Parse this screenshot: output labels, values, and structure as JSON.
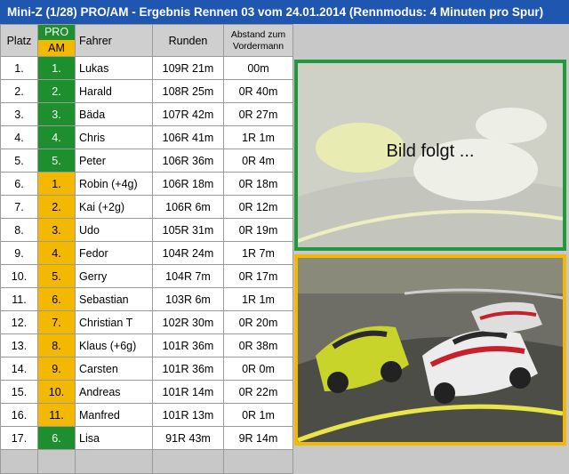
{
  "title": "Mini-Z (1/28) PRO/AM - Ergebnis Rennen 03 vom 24.01.2014 (Rennmodus: 4 Minuten pro Spur)",
  "headers": {
    "platz": "Platz",
    "pro": "PRO",
    "am": "AM",
    "fahrer": "Fahrer",
    "runden": "Runden",
    "abstand": "Abstand zum Vordermann"
  },
  "rows": [
    {
      "platz": "1.",
      "klasse": "pro",
      "klasse_platz": "1.",
      "fahrer": "Lukas",
      "runden": "109R 21m",
      "abstand": "00m"
    },
    {
      "platz": "2.",
      "klasse": "pro",
      "klasse_platz": "2.",
      "fahrer": "Harald",
      "runden": "108R 25m",
      "abstand": "0R 40m"
    },
    {
      "platz": "3.",
      "klasse": "pro",
      "klasse_platz": "3.",
      "fahrer": "Bäda",
      "runden": "107R 42m",
      "abstand": "0R 27m"
    },
    {
      "platz": "4.",
      "klasse": "pro",
      "klasse_platz": "4.",
      "fahrer": "Chris",
      "runden": "106R 41m",
      "abstand": "1R 1m"
    },
    {
      "platz": "5.",
      "klasse": "pro",
      "klasse_platz": "5.",
      "fahrer": "Peter",
      "runden": "106R 36m",
      "abstand": "0R 4m"
    },
    {
      "platz": "6.",
      "klasse": "am",
      "klasse_platz": "1.",
      "fahrer": "Robin (+4g)",
      "runden": "106R 18m",
      "abstand": "0R 18m"
    },
    {
      "platz": "7.",
      "klasse": "am",
      "klasse_platz": "2.",
      "fahrer": "Kai (+2g)",
      "runden": "106R 6m",
      "abstand": "0R 12m"
    },
    {
      "platz": "8.",
      "klasse": "am",
      "klasse_platz": "3.",
      "fahrer": "Udo",
      "runden": "105R 31m",
      "abstand": "0R 19m"
    },
    {
      "platz": "9.",
      "klasse": "am",
      "klasse_platz": "4.",
      "fahrer": "Fedor",
      "runden": "104R 24m",
      "abstand": "1R 7m"
    },
    {
      "platz": "10.",
      "klasse": "am",
      "klasse_platz": "5.",
      "fahrer": "Gerry",
      "runden": "104R 7m",
      "abstand": "0R 17m"
    },
    {
      "platz": "11.",
      "klasse": "am",
      "klasse_platz": "6.",
      "fahrer": "Sebastian",
      "runden": "103R 6m",
      "abstand": "1R 1m"
    },
    {
      "platz": "12.",
      "klasse": "am",
      "klasse_platz": "7.",
      "fahrer": "Christian T",
      "runden": "102R 30m",
      "abstand": "0R 20m"
    },
    {
      "platz": "13.",
      "klasse": "am",
      "klasse_platz": "8.",
      "fahrer": "Klaus (+6g)",
      "runden": "101R 36m",
      "abstand": "0R 38m"
    },
    {
      "platz": "14.",
      "klasse": "am",
      "klasse_platz": "9.",
      "fahrer": "Carsten",
      "runden": "101R 36m",
      "abstand": "0R 0m"
    },
    {
      "platz": "15.",
      "klasse": "am",
      "klasse_platz": "10.",
      "fahrer": "Andreas",
      "runden": "101R 14m",
      "abstand": "0R 22m"
    },
    {
      "platz": "16.",
      "klasse": "am",
      "klasse_platz": "11.",
      "fahrer": "Manfred",
      "runden": "101R 13m",
      "abstand": "0R 1m"
    },
    {
      "platz": "17.",
      "klasse": "pro",
      "klasse_platz": "6.",
      "fahrer": "Lisa",
      "runden": "91R 43m",
      "abstand": "9R 14m"
    }
  ],
  "photo_placeholder": "Bild folgt ...",
  "colors": {
    "title_bar": "#1f56b0",
    "pro": "#1e8f2e",
    "am": "#f3b800",
    "frame_green": "#1e9a3a",
    "frame_yellow": "#f3b800"
  }
}
